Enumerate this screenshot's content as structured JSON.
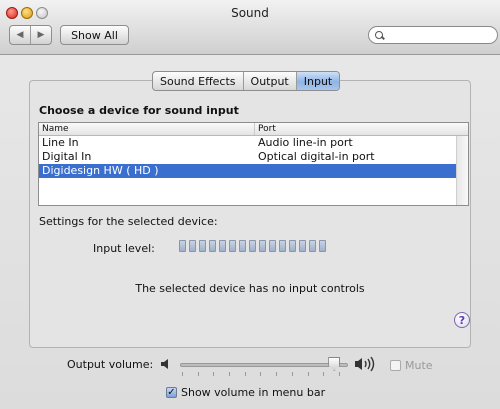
{
  "window": {
    "title": "Sound"
  },
  "toolbar": {
    "back_label": "◀",
    "forward_label": "▶",
    "show_all_label": "Show All",
    "search_placeholder": ""
  },
  "tabs": [
    {
      "label": "Sound Effects",
      "active": false
    },
    {
      "label": "Output",
      "active": false
    },
    {
      "label": "Input",
      "active": true
    }
  ],
  "input_pane": {
    "heading": "Choose a device for sound input",
    "columns": [
      "Name",
      "Port"
    ],
    "devices": [
      {
        "name": "Line In",
        "port": "Audio line-in port",
        "selected": false
      },
      {
        "name": "Digital In",
        "port": "Optical digital-in port",
        "selected": false
      },
      {
        "name": "Digidesign HW ( HD )",
        "port": "",
        "selected": true
      }
    ],
    "settings_label": "Settings for the selected device:",
    "input_level_label": "Input level:",
    "input_level_segments": 15,
    "input_level_value": 0,
    "no_controls_text": "The selected device has no input controls",
    "help_label": "?"
  },
  "bottom": {
    "output_volume_label": "Output volume:",
    "output_volume_value": 0.95,
    "mute_label": "Mute",
    "mute_checked": false,
    "show_volume_label": "Show volume in menu bar",
    "show_volume_checked": true,
    "checkmark": "✓"
  },
  "colors": {
    "selection": "#3a6fd0",
    "active_tab": "#9dbce8",
    "help": "#5a3fa6"
  }
}
